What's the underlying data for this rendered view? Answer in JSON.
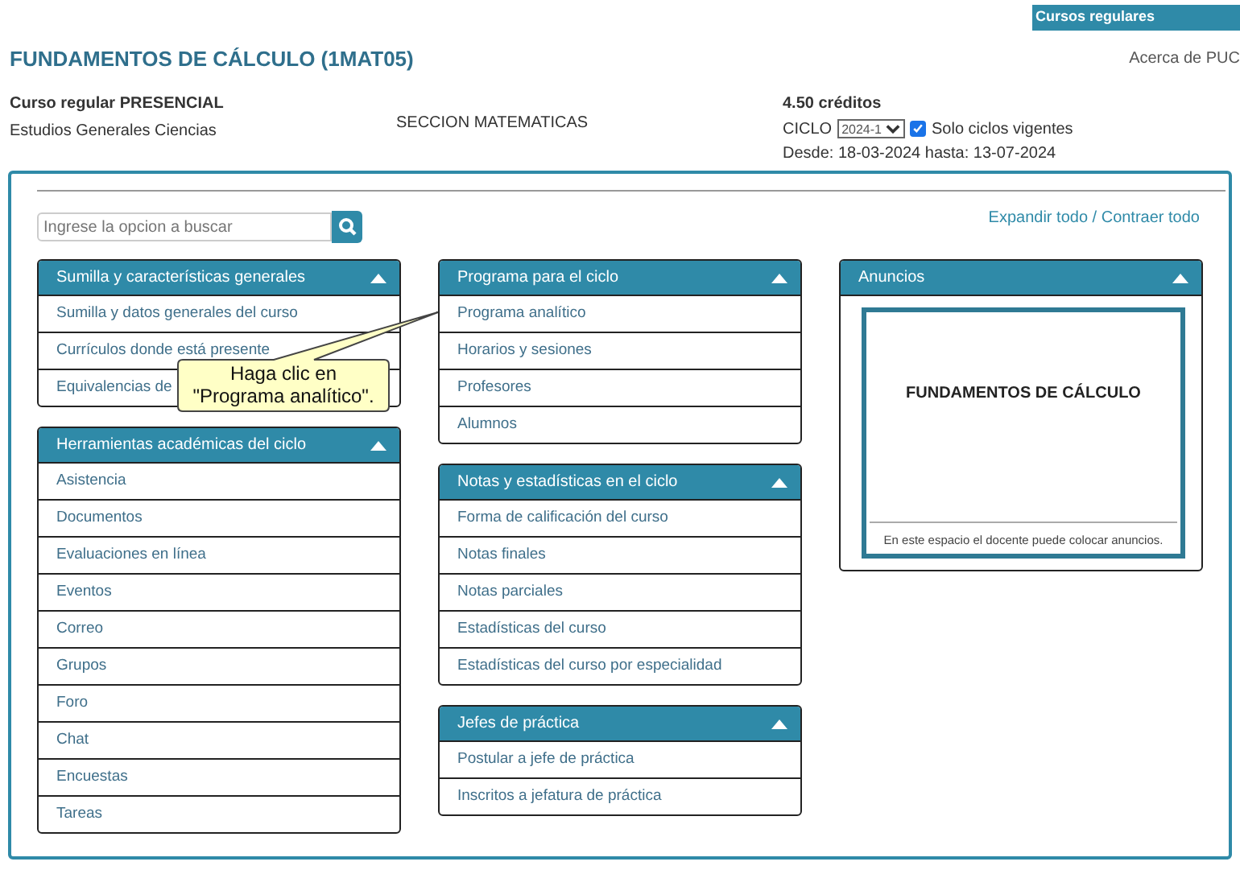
{
  "top_tab": "Cursos regulares",
  "title": "FUNDAMENTOS DE CÁLCULO (1MAT05)",
  "about_link": "Acerca de PUC",
  "course": {
    "modality": "Curso regular PRESENCIAL",
    "unit": "Estudios Generales Ciencias",
    "section": "SECCION MATEMATICAS",
    "credits": "4.50 créditos",
    "cycle_label": "CICLO",
    "cycle_value": "2024-1",
    "current_only": {
      "label": "Solo ciclos vigentes",
      "checked": true
    },
    "dates": "Desde: 18-03-2024 hasta: 13-07-2024"
  },
  "search": {
    "placeholder": "Ingrese la opcion a buscar"
  },
  "expand_link": "Expandir todo / Contraer todo",
  "columns": [
    [
      {
        "title": "Sumilla y características generales",
        "expanded": true,
        "items": [
          "Sumilla y datos generales del curso",
          "Currículos donde está presente",
          "Equivalencias de"
        ]
      },
      {
        "title": "Herramientas académicas del ciclo",
        "expanded": true,
        "items": [
          "Asistencia",
          "Documentos",
          "Evaluaciones en línea",
          "Eventos",
          "Correo",
          "Grupos",
          "Foro",
          "Chat",
          "Encuestas",
          "Tareas"
        ]
      }
    ],
    [
      {
        "title": "Programa para el ciclo",
        "expanded": true,
        "items": [
          "Programa analítico",
          "Horarios y sesiones",
          "Profesores",
          "Alumnos"
        ]
      },
      {
        "title": "Notas y estadísticas en el ciclo",
        "expanded": true,
        "items": [
          "Forma de calificación del curso",
          "Notas finales",
          "Notas parciales",
          "Estadísticas del curso",
          "Estadísticas del curso por especialidad"
        ]
      },
      {
        "title": "Jefes de práctica",
        "expanded": true,
        "items": [
          "Postular a jefe de práctica",
          "Inscritos a jefatura de práctica"
        ]
      }
    ]
  ],
  "announcements": {
    "title": "Anuncios",
    "expanded": true,
    "heading": "FUNDAMENTOS DE CÁLCULO",
    "note": "En este espacio el docente puede colocar anuncios."
  },
  "callout": {
    "lines": [
      "Haga clic en",
      "\"Programa analítico\"."
    ]
  }
}
